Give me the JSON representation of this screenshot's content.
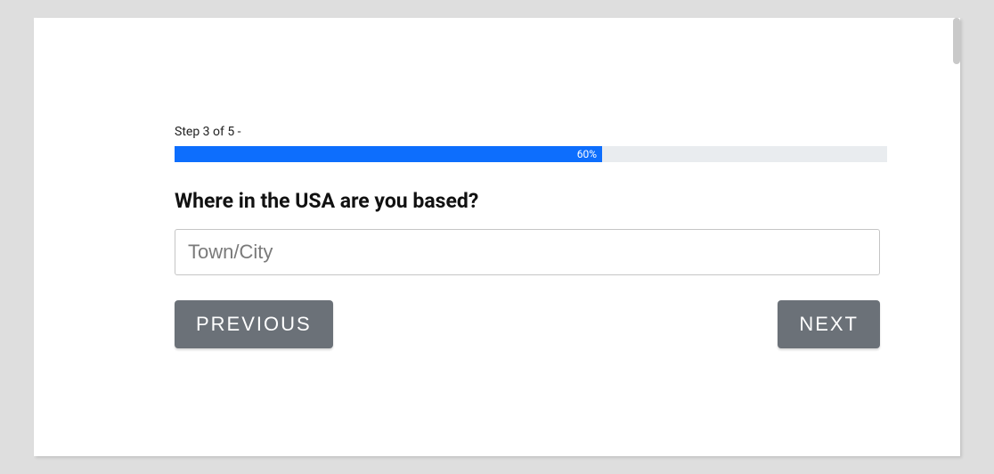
{
  "step": {
    "label": "Step 3 of 5 -"
  },
  "progress": {
    "percent": 60,
    "text": "60%"
  },
  "form": {
    "question": "Where in the USA are you based?",
    "input_placeholder": "Town/City",
    "input_value": ""
  },
  "buttons": {
    "previous": "PREVIOUS",
    "next": "NEXT"
  }
}
